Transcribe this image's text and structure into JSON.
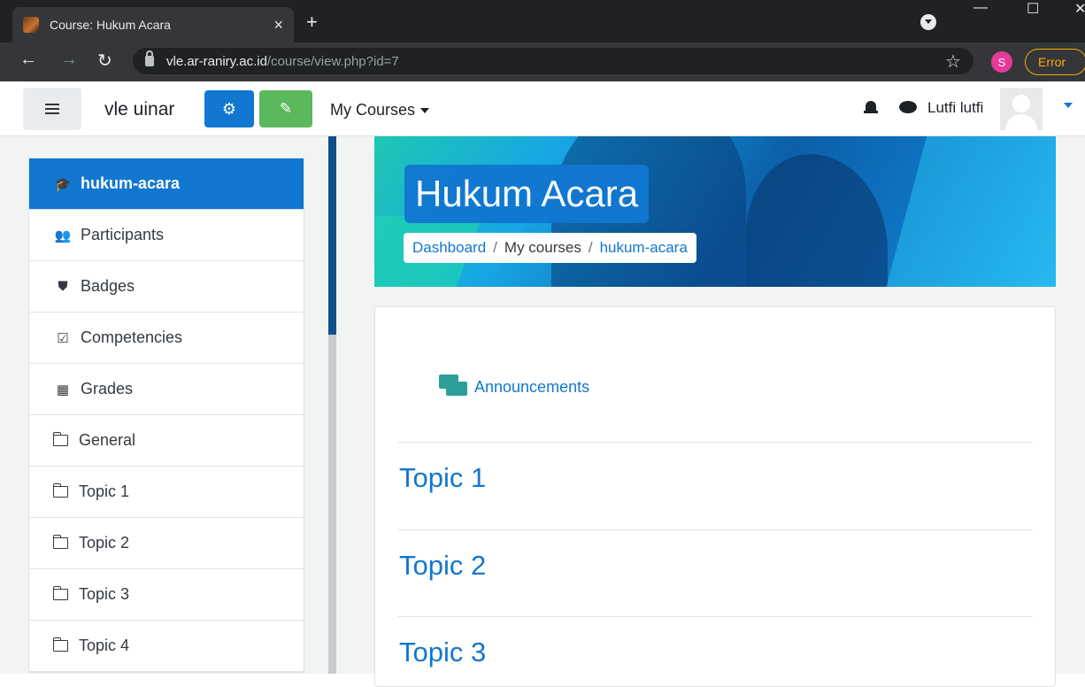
{
  "browser": {
    "tab_title": "Course: Hukum Acara",
    "tab_close": "×",
    "new_tab": "+",
    "url_host": "vle.ar-raniry.ac.id",
    "url_path": "/course/view.php?id=7",
    "profile_initial": "S",
    "error_label": "Error"
  },
  "navbar": {
    "site_name": "vle uinar",
    "my_courses_label": "My Courses",
    "user_name": "Lutfi lutfi"
  },
  "sidebar": {
    "items": [
      {
        "label": "hukum-acara",
        "icon": "graduation-cap-icon"
      },
      {
        "label": "Participants",
        "icon": "users-icon"
      },
      {
        "label": "Badges",
        "icon": "shield-icon"
      },
      {
        "label": "Competencies",
        "icon": "check-square-icon"
      },
      {
        "label": "Grades",
        "icon": "table-icon"
      },
      {
        "label": "General",
        "icon": "folder-icon"
      },
      {
        "label": "Topic 1",
        "icon": "folder-icon"
      },
      {
        "label": "Topic 2",
        "icon": "folder-icon"
      },
      {
        "label": "Topic 3",
        "icon": "folder-icon"
      },
      {
        "label": "Topic 4",
        "icon": "folder-icon"
      }
    ]
  },
  "header": {
    "course_title": "Hukum Acara",
    "breadcrumb": [
      "Dashboard",
      "My courses",
      "hukum-acara"
    ],
    "breadcrumb_sep": "/"
  },
  "main": {
    "announcements_label": "Announcements",
    "topics": [
      "Topic 1",
      "Topic 2",
      "Topic 3"
    ]
  },
  "colors": {
    "primary": "#1177d1",
    "edit_button": "#5cb85c",
    "forum_icon": "#2c9f9a"
  }
}
